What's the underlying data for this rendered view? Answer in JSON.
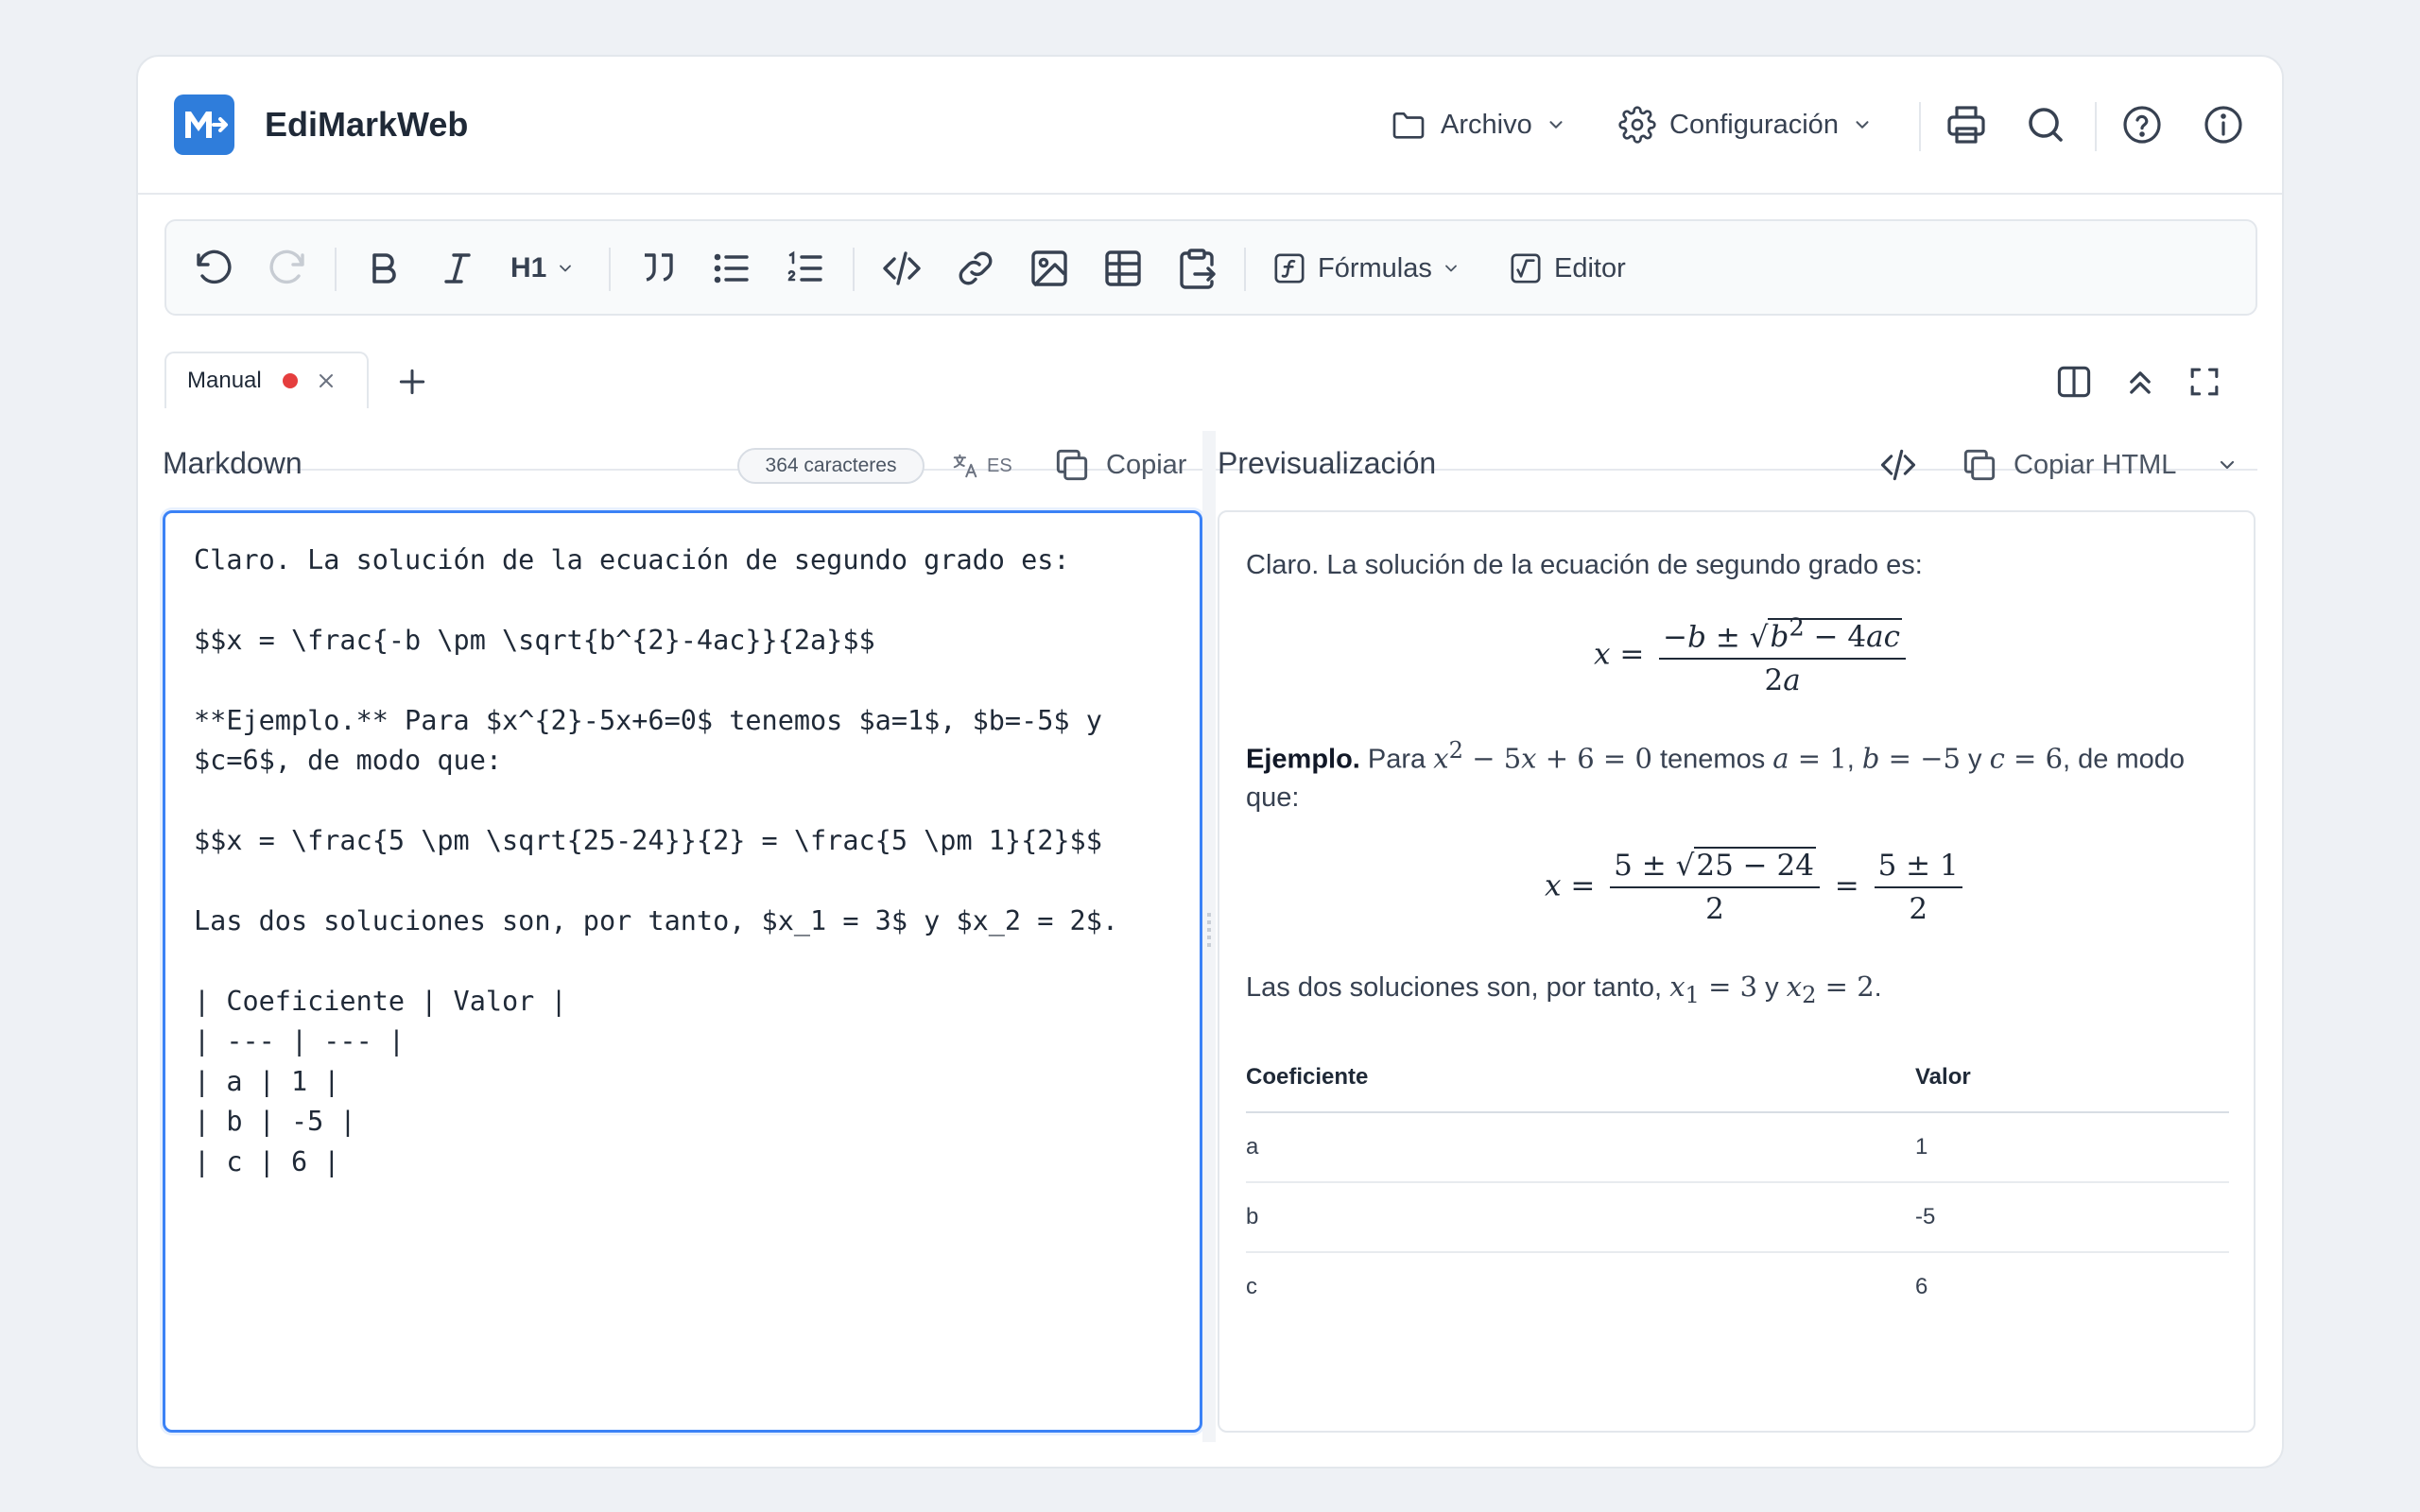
{
  "app": {
    "title": "EdiMarkWeb"
  },
  "header": {
    "file_label": "Archivo",
    "settings_label": "Configuración"
  },
  "toolbar": {
    "heading_label": "H1",
    "formulas_label": "Fórmulas",
    "editor_label": "Editor"
  },
  "tabs": [
    {
      "label": "Manual",
      "unsaved": true
    }
  ],
  "markdown_panel": {
    "title": "Markdown",
    "char_count": "364 caracteres",
    "lang": "ES",
    "copy_label": "Copiar",
    "lines": [
      "Claro. La solución de la ecuación de segundo grado es:",
      "",
      "$$x = \\frac{-b \\pm \\sqrt{b^{2}-4ac}}{2a}$$",
      "",
      "**Ejemplo.** Para $x^{2}-5x+6=0$ tenemos $a=1$, $b=-5$ y",
      "$c=6$, de modo que:",
      "",
      "$$x = \\frac{5 \\pm \\sqrt{25-24}}{2} = \\frac{5 \\pm 1}{2}$$",
      "",
      "Las dos soluciones son, por tanto, $x_1 = 3$ y $x_2 = 2$.",
      "",
      "| Coeficiente | Valor |",
      "| --- | --- |",
      "| a | 1 |",
      "| b | -5 |",
      "| c | 6 |"
    ]
  },
  "preview_panel": {
    "title": "Previsualización",
    "copy_html_label": "Copiar HTML",
    "intro": "Claro. La solución de la ecuación de segundo grado es:",
    "example_bold": "Ejemplo.",
    "example_text_1": "Para",
    "example_text_2": "tenemos",
    "example_text_3": "y",
    "example_text_4": ", de modo",
    "example_text_5": "que:",
    "solutions_text_1": "Las dos soluciones son, por tanto,",
    "solutions_text_2": "y",
    "table": {
      "headers": [
        "Coeficiente",
        "Valor"
      ],
      "rows": [
        [
          "a",
          "1"
        ],
        [
          "b",
          "-5"
        ],
        [
          "c",
          "6"
        ]
      ]
    }
  },
  "colors": {
    "accent": "#3b82f6",
    "logo": "#2f7ddb",
    "unsaved_dot": "#e53e3e"
  }
}
